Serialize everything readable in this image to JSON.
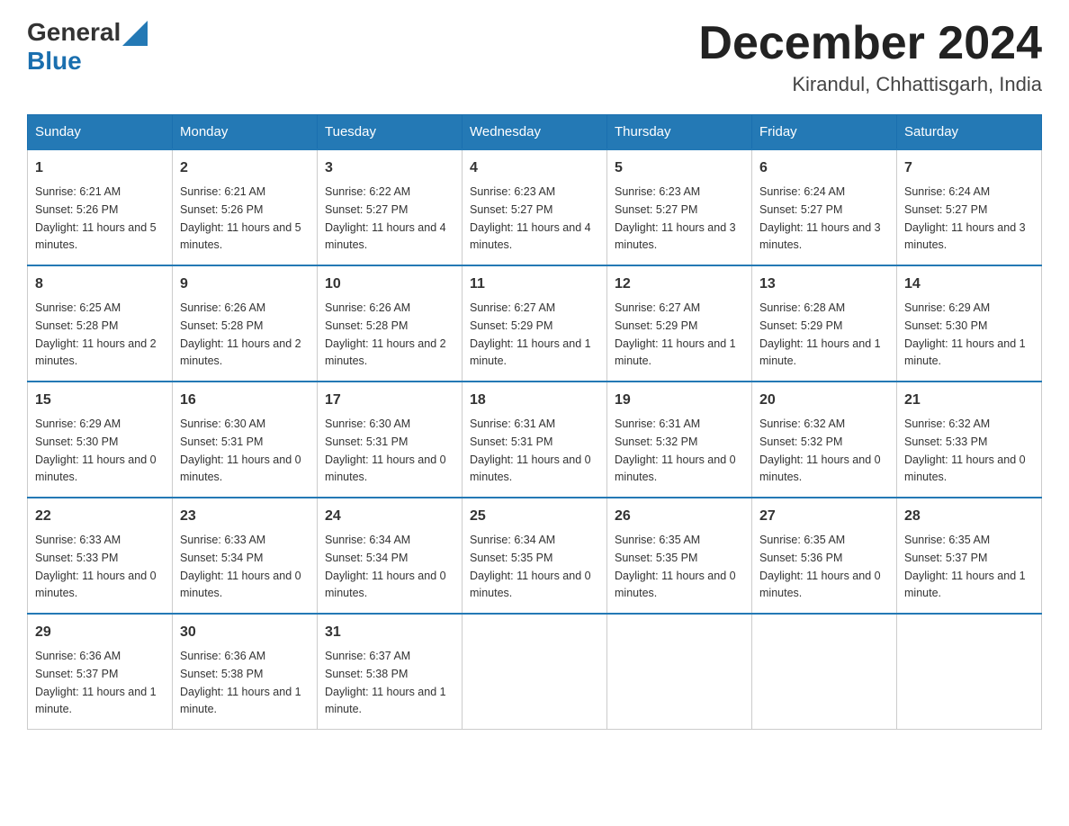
{
  "header": {
    "logo_general": "General",
    "logo_blue": "Blue",
    "month_title": "December 2024",
    "location": "Kirandul, Chhattisgarh, India"
  },
  "weekdays": [
    "Sunday",
    "Monday",
    "Tuesday",
    "Wednesday",
    "Thursday",
    "Friday",
    "Saturday"
  ],
  "weeks": [
    [
      {
        "day": "1",
        "sunrise": "6:21 AM",
        "sunset": "5:26 PM",
        "daylight": "11 hours and 5 minutes."
      },
      {
        "day": "2",
        "sunrise": "6:21 AM",
        "sunset": "5:26 PM",
        "daylight": "11 hours and 5 minutes."
      },
      {
        "day": "3",
        "sunrise": "6:22 AM",
        "sunset": "5:27 PM",
        "daylight": "11 hours and 4 minutes."
      },
      {
        "day": "4",
        "sunrise": "6:23 AM",
        "sunset": "5:27 PM",
        "daylight": "11 hours and 4 minutes."
      },
      {
        "day": "5",
        "sunrise": "6:23 AM",
        "sunset": "5:27 PM",
        "daylight": "11 hours and 3 minutes."
      },
      {
        "day": "6",
        "sunrise": "6:24 AM",
        "sunset": "5:27 PM",
        "daylight": "11 hours and 3 minutes."
      },
      {
        "day": "7",
        "sunrise": "6:24 AM",
        "sunset": "5:27 PM",
        "daylight": "11 hours and 3 minutes."
      }
    ],
    [
      {
        "day": "8",
        "sunrise": "6:25 AM",
        "sunset": "5:28 PM",
        "daylight": "11 hours and 2 minutes."
      },
      {
        "day": "9",
        "sunrise": "6:26 AM",
        "sunset": "5:28 PM",
        "daylight": "11 hours and 2 minutes."
      },
      {
        "day": "10",
        "sunrise": "6:26 AM",
        "sunset": "5:28 PM",
        "daylight": "11 hours and 2 minutes."
      },
      {
        "day": "11",
        "sunrise": "6:27 AM",
        "sunset": "5:29 PM",
        "daylight": "11 hours and 1 minute."
      },
      {
        "day": "12",
        "sunrise": "6:27 AM",
        "sunset": "5:29 PM",
        "daylight": "11 hours and 1 minute."
      },
      {
        "day": "13",
        "sunrise": "6:28 AM",
        "sunset": "5:29 PM",
        "daylight": "11 hours and 1 minute."
      },
      {
        "day": "14",
        "sunrise": "6:29 AM",
        "sunset": "5:30 PM",
        "daylight": "11 hours and 1 minute."
      }
    ],
    [
      {
        "day": "15",
        "sunrise": "6:29 AM",
        "sunset": "5:30 PM",
        "daylight": "11 hours and 0 minutes."
      },
      {
        "day": "16",
        "sunrise": "6:30 AM",
        "sunset": "5:31 PM",
        "daylight": "11 hours and 0 minutes."
      },
      {
        "day": "17",
        "sunrise": "6:30 AM",
        "sunset": "5:31 PM",
        "daylight": "11 hours and 0 minutes."
      },
      {
        "day": "18",
        "sunrise": "6:31 AM",
        "sunset": "5:31 PM",
        "daylight": "11 hours and 0 minutes."
      },
      {
        "day": "19",
        "sunrise": "6:31 AM",
        "sunset": "5:32 PM",
        "daylight": "11 hours and 0 minutes."
      },
      {
        "day": "20",
        "sunrise": "6:32 AM",
        "sunset": "5:32 PM",
        "daylight": "11 hours and 0 minutes."
      },
      {
        "day": "21",
        "sunrise": "6:32 AM",
        "sunset": "5:33 PM",
        "daylight": "11 hours and 0 minutes."
      }
    ],
    [
      {
        "day": "22",
        "sunrise": "6:33 AM",
        "sunset": "5:33 PM",
        "daylight": "11 hours and 0 minutes."
      },
      {
        "day": "23",
        "sunrise": "6:33 AM",
        "sunset": "5:34 PM",
        "daylight": "11 hours and 0 minutes."
      },
      {
        "day": "24",
        "sunrise": "6:34 AM",
        "sunset": "5:34 PM",
        "daylight": "11 hours and 0 minutes."
      },
      {
        "day": "25",
        "sunrise": "6:34 AM",
        "sunset": "5:35 PM",
        "daylight": "11 hours and 0 minutes."
      },
      {
        "day": "26",
        "sunrise": "6:35 AM",
        "sunset": "5:35 PM",
        "daylight": "11 hours and 0 minutes."
      },
      {
        "day": "27",
        "sunrise": "6:35 AM",
        "sunset": "5:36 PM",
        "daylight": "11 hours and 0 minutes."
      },
      {
        "day": "28",
        "sunrise": "6:35 AM",
        "sunset": "5:37 PM",
        "daylight": "11 hours and 1 minute."
      }
    ],
    [
      {
        "day": "29",
        "sunrise": "6:36 AM",
        "sunset": "5:37 PM",
        "daylight": "11 hours and 1 minute."
      },
      {
        "day": "30",
        "sunrise": "6:36 AM",
        "sunset": "5:38 PM",
        "daylight": "11 hours and 1 minute."
      },
      {
        "day": "31",
        "sunrise": "6:37 AM",
        "sunset": "5:38 PM",
        "daylight": "11 hours and 1 minute."
      },
      null,
      null,
      null,
      null
    ]
  ]
}
